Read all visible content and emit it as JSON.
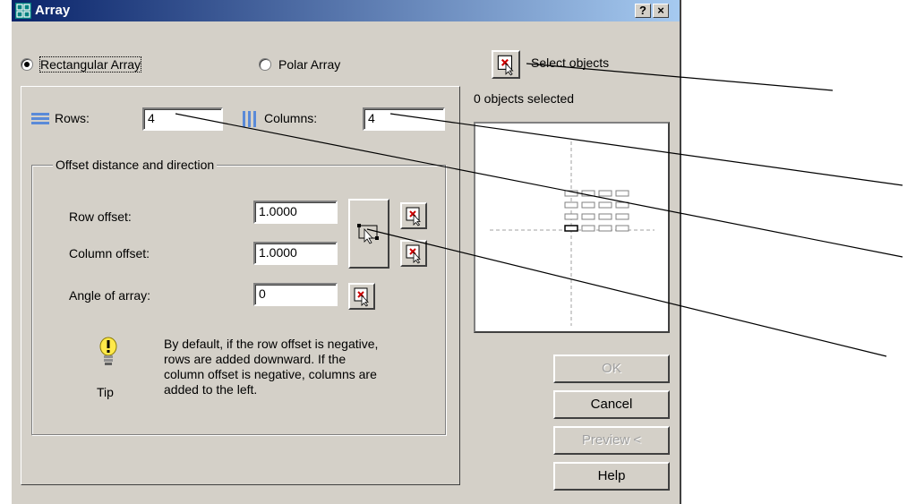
{
  "window": {
    "title": "Array",
    "help_glyph": "?",
    "close_glyph": "×"
  },
  "mode": {
    "rectangular_label": "Rectangular Array",
    "polar_label": "Polar Array",
    "selected": "rectangular"
  },
  "rows": {
    "label": "Rows:",
    "value": "4"
  },
  "columns": {
    "label": "Columns:",
    "value": "4"
  },
  "offset_group": {
    "title": "Offset distance and direction",
    "row_offset_label": "Row offset:",
    "row_offset_value": "1.0000",
    "column_offset_label": "Column offset:",
    "column_offset_value": "1.0000",
    "angle_label": "Angle of array:",
    "angle_value": "0"
  },
  "tip": {
    "caption": "Tip",
    "lines": [
      "By default, if the row offset is negative,",
      "rows are added downward.  If the",
      "column offset is negative, columns are",
      "added to the left."
    ]
  },
  "select": {
    "label": "Select objects",
    "status": "0 objects selected"
  },
  "buttons": {
    "ok": "OK",
    "cancel": "Cancel",
    "preview": "Preview <",
    "help": "Help"
  },
  "preview_grid": {
    "rows": 4,
    "columns": 4
  },
  "icons": {
    "title": "array-icon",
    "rows": "rows-icon",
    "columns": "columns-icon",
    "pick": "pick-point-icon",
    "pick_both": "pick-both-offsets-icon",
    "select": "select-objects-icon",
    "tip": "lightbulb-icon"
  },
  "colors": {
    "titlebar_start": "#0a246a",
    "titlebar_end": "#a6caf0",
    "dialog_bg": "#d4d0c8",
    "pick_accent": "#cc0000"
  }
}
